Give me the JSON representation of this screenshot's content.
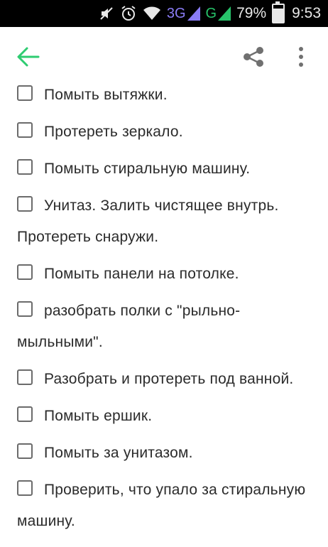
{
  "status_bar": {
    "network_primary": "3G",
    "network_secondary": "G",
    "battery_percent": "79%",
    "battery_level": 0.79,
    "time": "9:53",
    "icons": [
      "mute-icon",
      "alarm-icon",
      "wifi-icon",
      "signal-icon",
      "signal-icon",
      "battery-icon"
    ]
  },
  "toolbar": {
    "back_icon": "arrow-left-icon",
    "share_icon": "share-icon",
    "more_icon": "more-vertical-icon",
    "accent_color": "#2ecc71"
  },
  "checklist": {
    "items": [
      {
        "text": "Помыть вытяжки.",
        "checked": false
      },
      {
        "text": "Протереть зеркало.",
        "checked": false
      },
      {
        "text": "Помыть стиральную машину.",
        "checked": false
      },
      {
        "text": "Унитаз. Залить чистящее внутрь. Протереть снаружи.",
        "checked": false
      },
      {
        "text": "Помыть панели на потолке.",
        "checked": false
      },
      {
        "text": "разобрать полки с \"рыльно-мыльными\".",
        "checked": false
      },
      {
        "text": "Разобрать и протереть под ванной.",
        "checked": false
      },
      {
        "text": "Помыть ершик.",
        "checked": false
      },
      {
        "text": "Помыть за унитазом.",
        "checked": false
      },
      {
        "text": "Проверить, что упало за стиральную машину.",
        "checked": false
      }
    ]
  }
}
